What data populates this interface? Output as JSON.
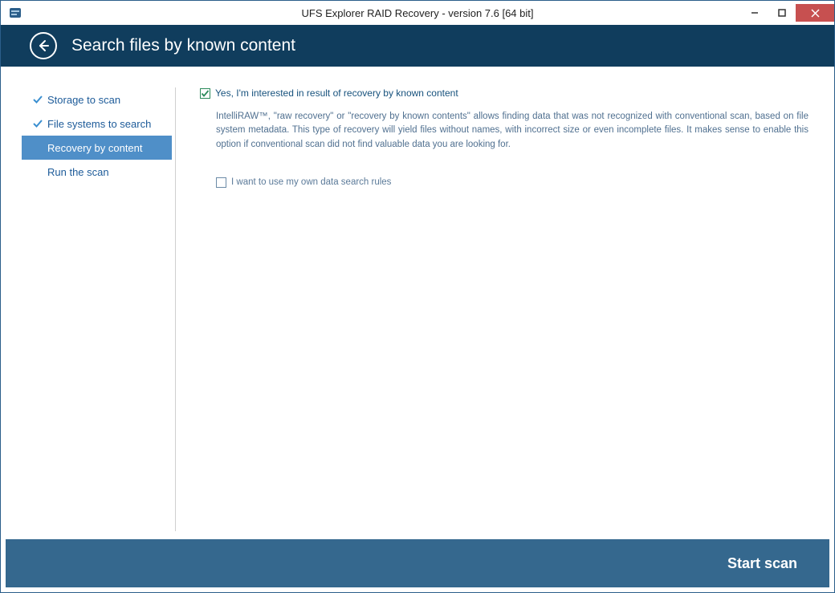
{
  "window": {
    "title": "UFS Explorer RAID Recovery - version 7.6 [64 bit]"
  },
  "header": {
    "title": "Search files by known content"
  },
  "sidebar": {
    "items": [
      {
        "label": "Storage to scan",
        "done": true,
        "active": false
      },
      {
        "label": "File systems to search",
        "done": true,
        "active": false
      },
      {
        "label": "Recovery by content",
        "done": false,
        "active": true
      },
      {
        "label": "Run the scan",
        "done": false,
        "active": false
      }
    ]
  },
  "content": {
    "option1_label": "Yes, I'm interested in result of recovery by known content",
    "option1_checked": true,
    "description": "IntelliRAW™, \"raw recovery\" or \"recovery by known contents\" allows finding data that was not recognized with conventional scan, based on file system metadata. This type of recovery will yield files without names, with incorrect size or even incomplete files. It makes sense to enable this option if conventional scan did not find valuable data you are looking for.",
    "option2_label": "I want to use my own data search rules",
    "option2_checked": false
  },
  "footer": {
    "primary_button": "Start scan"
  }
}
